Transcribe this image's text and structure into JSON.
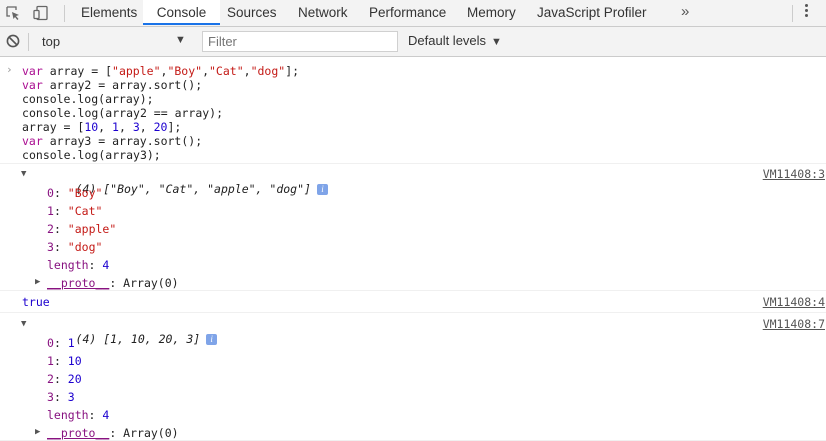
{
  "tabs": [
    "Elements",
    "Console",
    "Sources",
    "Network",
    "Performance",
    "Memory",
    "JavaScript Profiler"
  ],
  "active_tab": "Console",
  "more_tabs_glyph": "»",
  "filter_bar": {
    "context_label": "top",
    "filter_placeholder": "Filter",
    "levels_label": "Default levels"
  },
  "input_code": [
    "var array = [\"apple\",\"Boy\",\"Cat\",\"dog\"];",
    "var array2 = array.sort();",
    "console.log(array);",
    "console.log(array2 == array);",
    "array = [10, 1, 3, 20];",
    "var array3 = array.sort();",
    "console.log(array3);"
  ],
  "outputs": [
    {
      "summary": "(4) [\"Boy\", \"Cat\", \"apple\", \"dog\"]",
      "source": "VM11408:3",
      "entries": [
        {
          "key": "0",
          "value": "\"Boy\""
        },
        {
          "key": "1",
          "value": "\"Cat\""
        },
        {
          "key": "2",
          "value": "\"apple\""
        },
        {
          "key": "3",
          "value": "\"dog\""
        }
      ],
      "length_key": "length",
      "length_value": "4",
      "proto_key": "__proto__",
      "proto_value": "Array(0)"
    },
    {
      "value": "true",
      "source": "VM11408:4"
    },
    {
      "summary": "(4) [1, 10, 20, 3]",
      "source": "VM11408:7",
      "entries": [
        {
          "key": "0",
          "value": "1"
        },
        {
          "key": "1",
          "value": "10"
        },
        {
          "key": "2",
          "value": "20"
        },
        {
          "key": "3",
          "value": "3"
        }
      ],
      "length_key": "length",
      "length_value": "4",
      "proto_key": "__proto__",
      "proto_value": "Array(0)"
    }
  ],
  "info_badge": "i",
  "icons": [
    "inspect-element-icon",
    "device-toolbar-icon",
    "clear-console-icon",
    "more-options-icon",
    "expand-triangle-icon"
  ],
  "colors": {
    "keyword": "#aa0d91",
    "string": "#c41a16",
    "number": "#1c00cf",
    "property": "#881280",
    "active_tab": "#1a73e8"
  }
}
